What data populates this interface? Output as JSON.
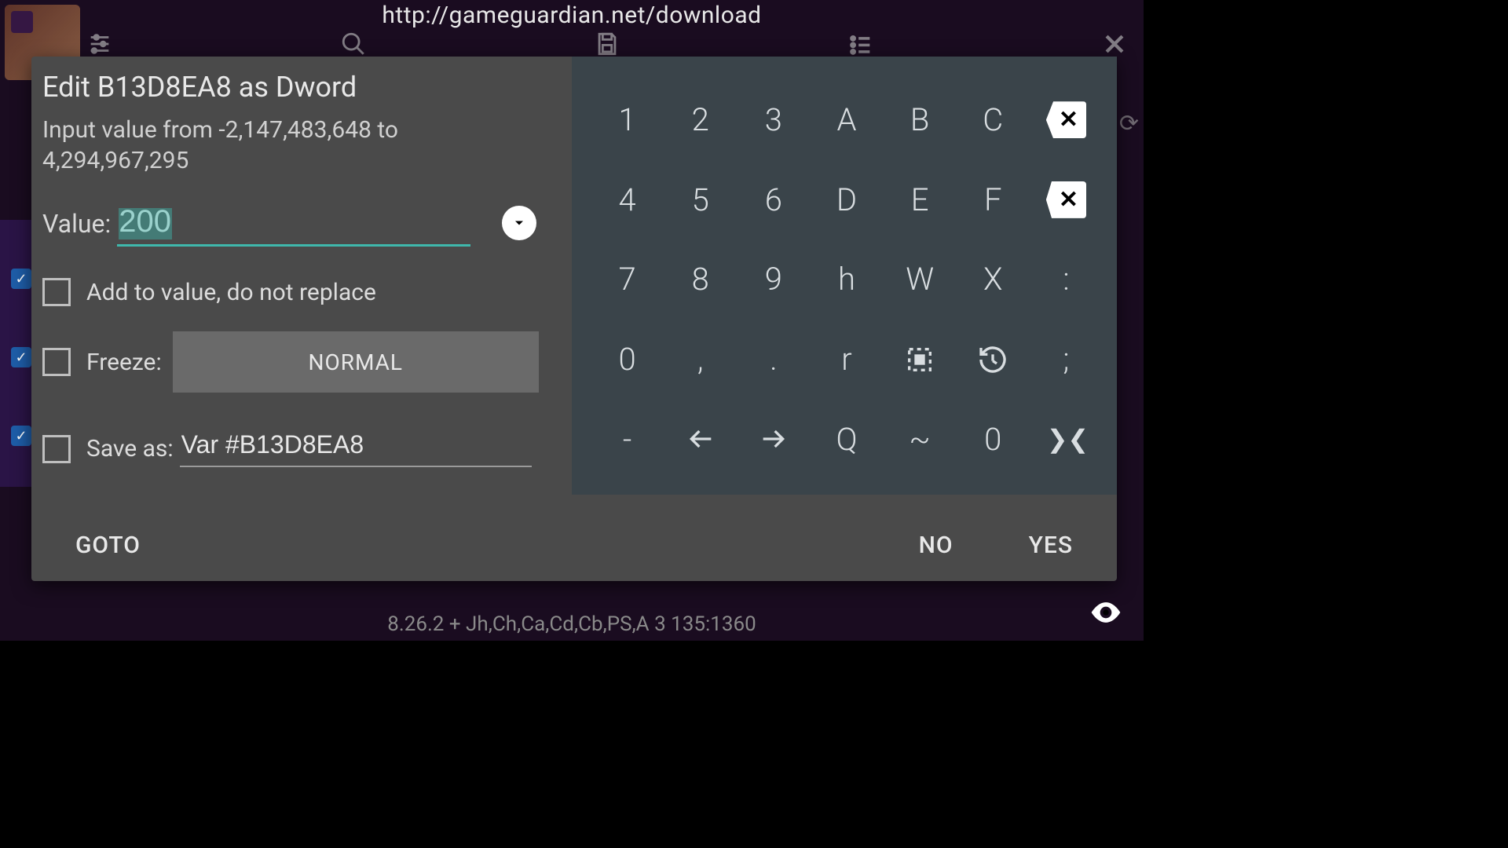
{
  "url": "http://gameguardian.net/download",
  "dialog": {
    "title": "Edit B13D8EA8 as Dword",
    "subtitle": "Input value from -2,147,483,648 to 4,294,967,295",
    "value_label": "Value:",
    "value": "200",
    "add_label": "Add to value, do not replace",
    "freeze_label": "Freeze:",
    "freeze_mode": "NORMAL",
    "saveas_label": "Save as:",
    "saveas_value": "Var #B13D8EA8",
    "goto": "GOTO",
    "no": "NO",
    "yes": "YES"
  },
  "keypad": {
    "rows": [
      [
        "1",
        "2",
        "3",
        "A",
        "B",
        "C",
        "__BSP1__"
      ],
      [
        "4",
        "5",
        "6",
        "D",
        "E",
        "F",
        "__BSP2__"
      ],
      [
        "7",
        "8",
        "9",
        "h",
        "W",
        "X",
        ":"
      ],
      [
        "0",
        ",",
        ".",
        "r",
        "__SEL__",
        "__HIST__",
        ";"
      ],
      [
        "-",
        "__LARR__",
        "__RARR__",
        "Q",
        "~",
        "0",
        "__SWAP__"
      ]
    ]
  },
  "footer": "8.26.2  +  Jh,Ch,Ca,Cd,Cb,PS,A  3  135:1360"
}
